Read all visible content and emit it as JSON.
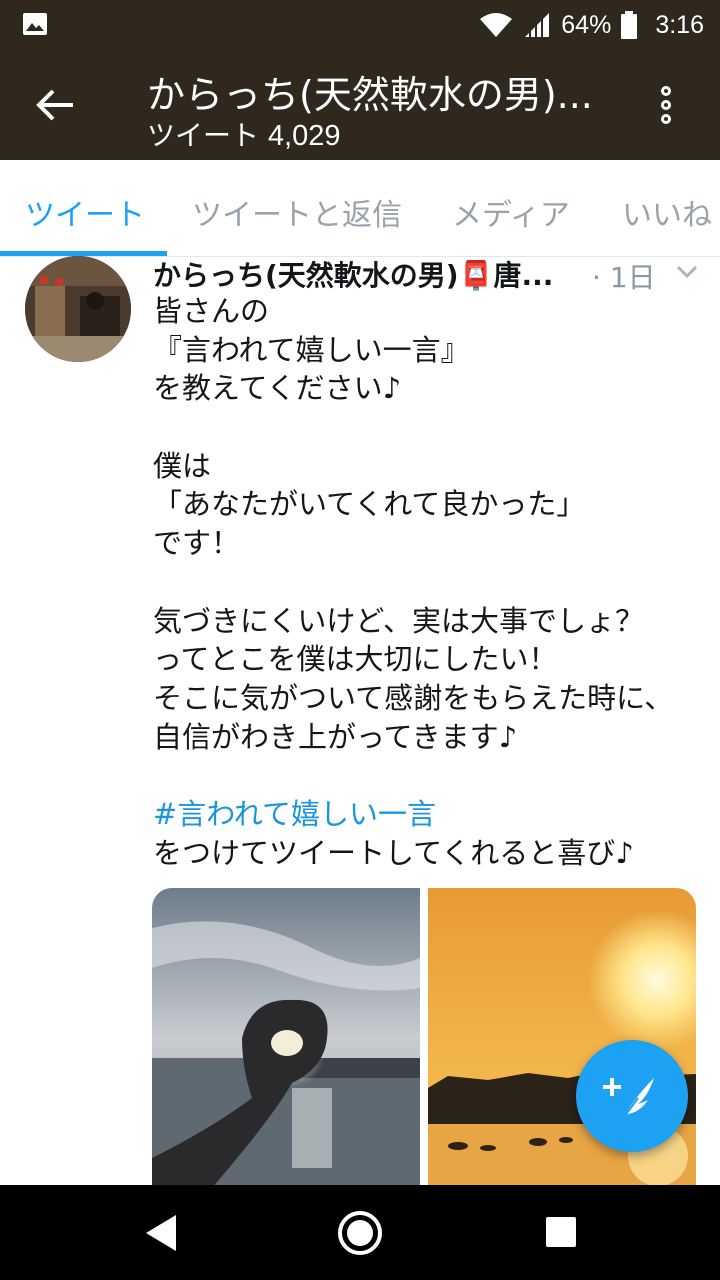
{
  "status_bar": {
    "battery": "64%",
    "time": "3:16"
  },
  "header": {
    "title": "からっち(天然軟水の男)...",
    "subtitle_label": "ツイート",
    "tweet_count": "4,029"
  },
  "tabs": [
    {
      "label": "ツイート",
      "active": true
    },
    {
      "label": "ツイートと返信",
      "active": false
    },
    {
      "label": "メディア",
      "active": false
    },
    {
      "label": "いいね",
      "active": false
    }
  ],
  "tweet": {
    "author": "からっち(天然軟水の男)📮唐...",
    "time": "· 1日",
    "body_lines": [
      "皆さんの",
      "『言われて嬉しい一言』",
      "を教えてください♪",
      "",
      "僕は",
      "「あなたがいてくれて良かった」",
      "です！",
      "",
      "気づきにくいけど、実は大事でしょ？",
      "ってとこを僕は大切にしたい！",
      "そこに気がついて感謝をもらえた時に、",
      "自信がわき上がってきます♪",
      ""
    ],
    "hashtag": "#言われて嬉しい一言",
    "closing_line": "をつけてツイートしてくれると喜び♪"
  },
  "colors": {
    "header_bg": "#2f281d",
    "accent": "#1da1f2",
    "hashtag": "#1b95e0"
  },
  "icons": {
    "status_left": "image-icon",
    "back": "arrow-left-icon",
    "more": "more-vertical-icon",
    "caret": "chevron-down-icon",
    "compose": "compose-feather-icon",
    "nav_back": "triangle-back-icon",
    "nav_home": "circle-home-icon",
    "nav_recents": "square-recents-icon"
  }
}
